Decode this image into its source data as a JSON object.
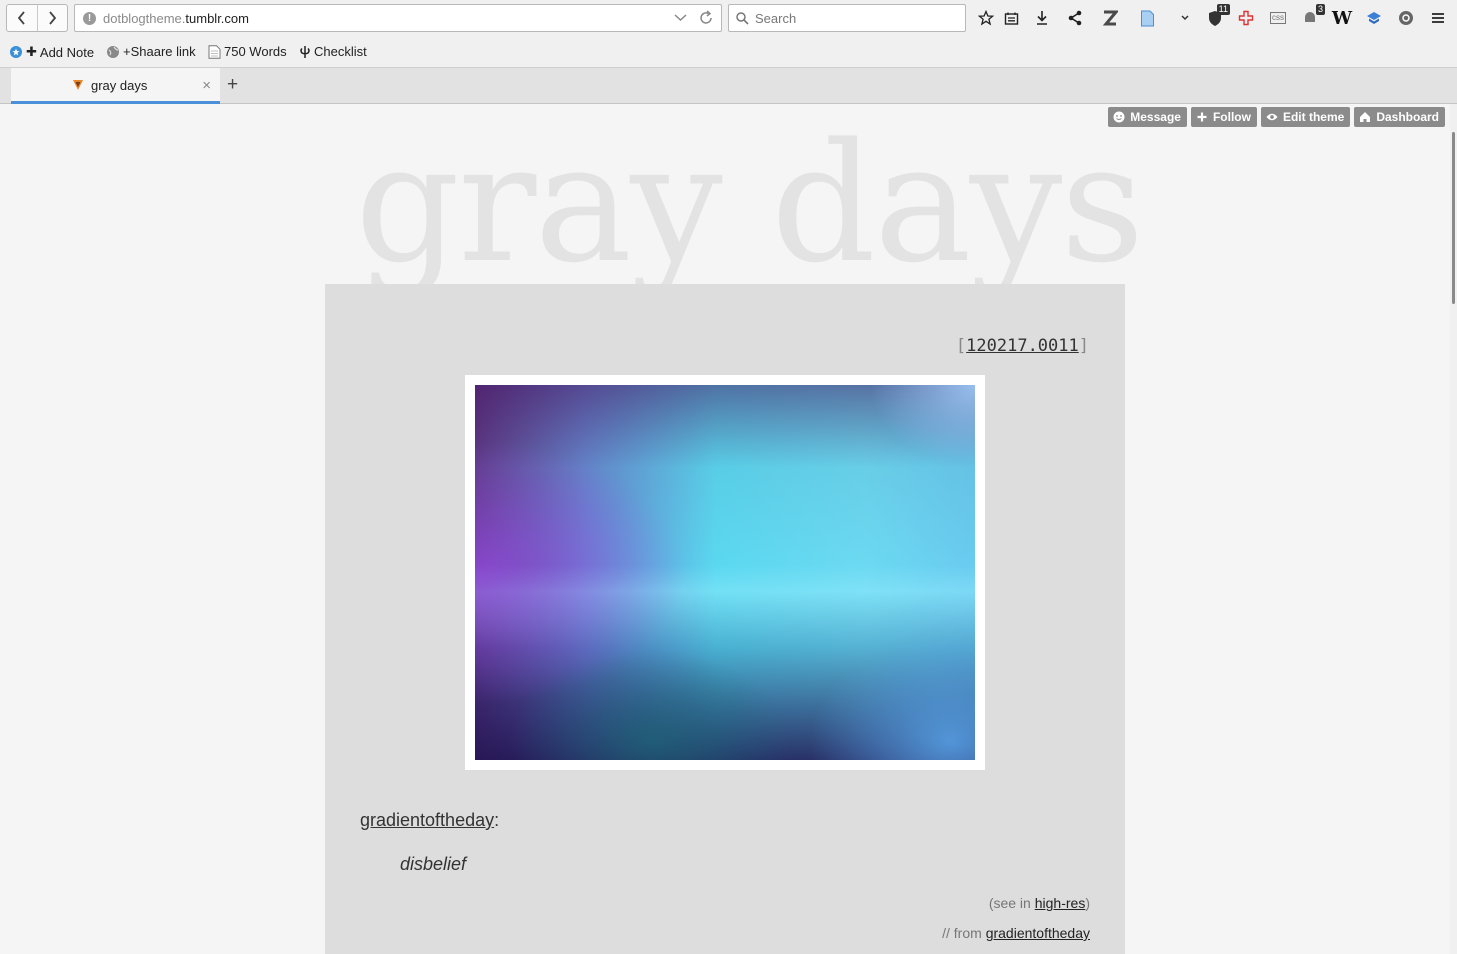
{
  "browser": {
    "url_prefix": "dotblogtheme.",
    "url_domain": "tumblr.com",
    "search_placeholder": "Search",
    "icons": [
      "back-icon",
      "forward-icon",
      "info-icon",
      "dropdown-arrow-icon",
      "reload-icon",
      "search-icon",
      "bookmark-star-icon",
      "reading-list-icon",
      "download-icon",
      "share-icon",
      "zotero-icon",
      "document-icon",
      "overflow-chevron-icon",
      "ublock-shield-icon",
      "first-aid-icon",
      "css-icon",
      "notification-icon",
      "wikiwand-icon",
      "dropbox-icon",
      "power-icon",
      "hamburger-menu-icon"
    ],
    "badges": {
      "shield": "11",
      "notifications": "3"
    },
    "toolbar_labels": {
      "css": "css",
      "wikiwand": "W"
    },
    "bookmarks": [
      {
        "label": "Add Note",
        "prefix": "✚"
      },
      {
        "label": "+Shaare link"
      },
      {
        "label": "750 Words"
      },
      {
        "label": "Checklist"
      }
    ],
    "tab": {
      "title": "gray days"
    },
    "newtab_label": "+"
  },
  "tumblr_controls": [
    {
      "label": "Message",
      "icon": "message-icon"
    },
    {
      "label": "Follow",
      "icon": "plus-icon"
    },
    {
      "label": "Edit theme",
      "icon": "eye-icon"
    },
    {
      "label": "Dashboard",
      "icon": "home-icon"
    }
  ],
  "blog": {
    "title": "gray days",
    "permalink": "120217.0011",
    "permalink_open": "[",
    "permalink_close": "]",
    "caption_author": "gradientoftheday",
    "caption_colon": ":",
    "quote": "disbelief",
    "see_in_prefix": "(see in ",
    "highres_label": "high-res",
    "see_in_suffix": ")",
    "from_prefix": "// from ",
    "from_author": "gradientoftheday"
  },
  "colors": {
    "accent_tab": "#4a90d9",
    "control_bg": "#8b8b8b",
    "title_gray": "#e3e3e3",
    "post_bg": "#dddddd"
  }
}
